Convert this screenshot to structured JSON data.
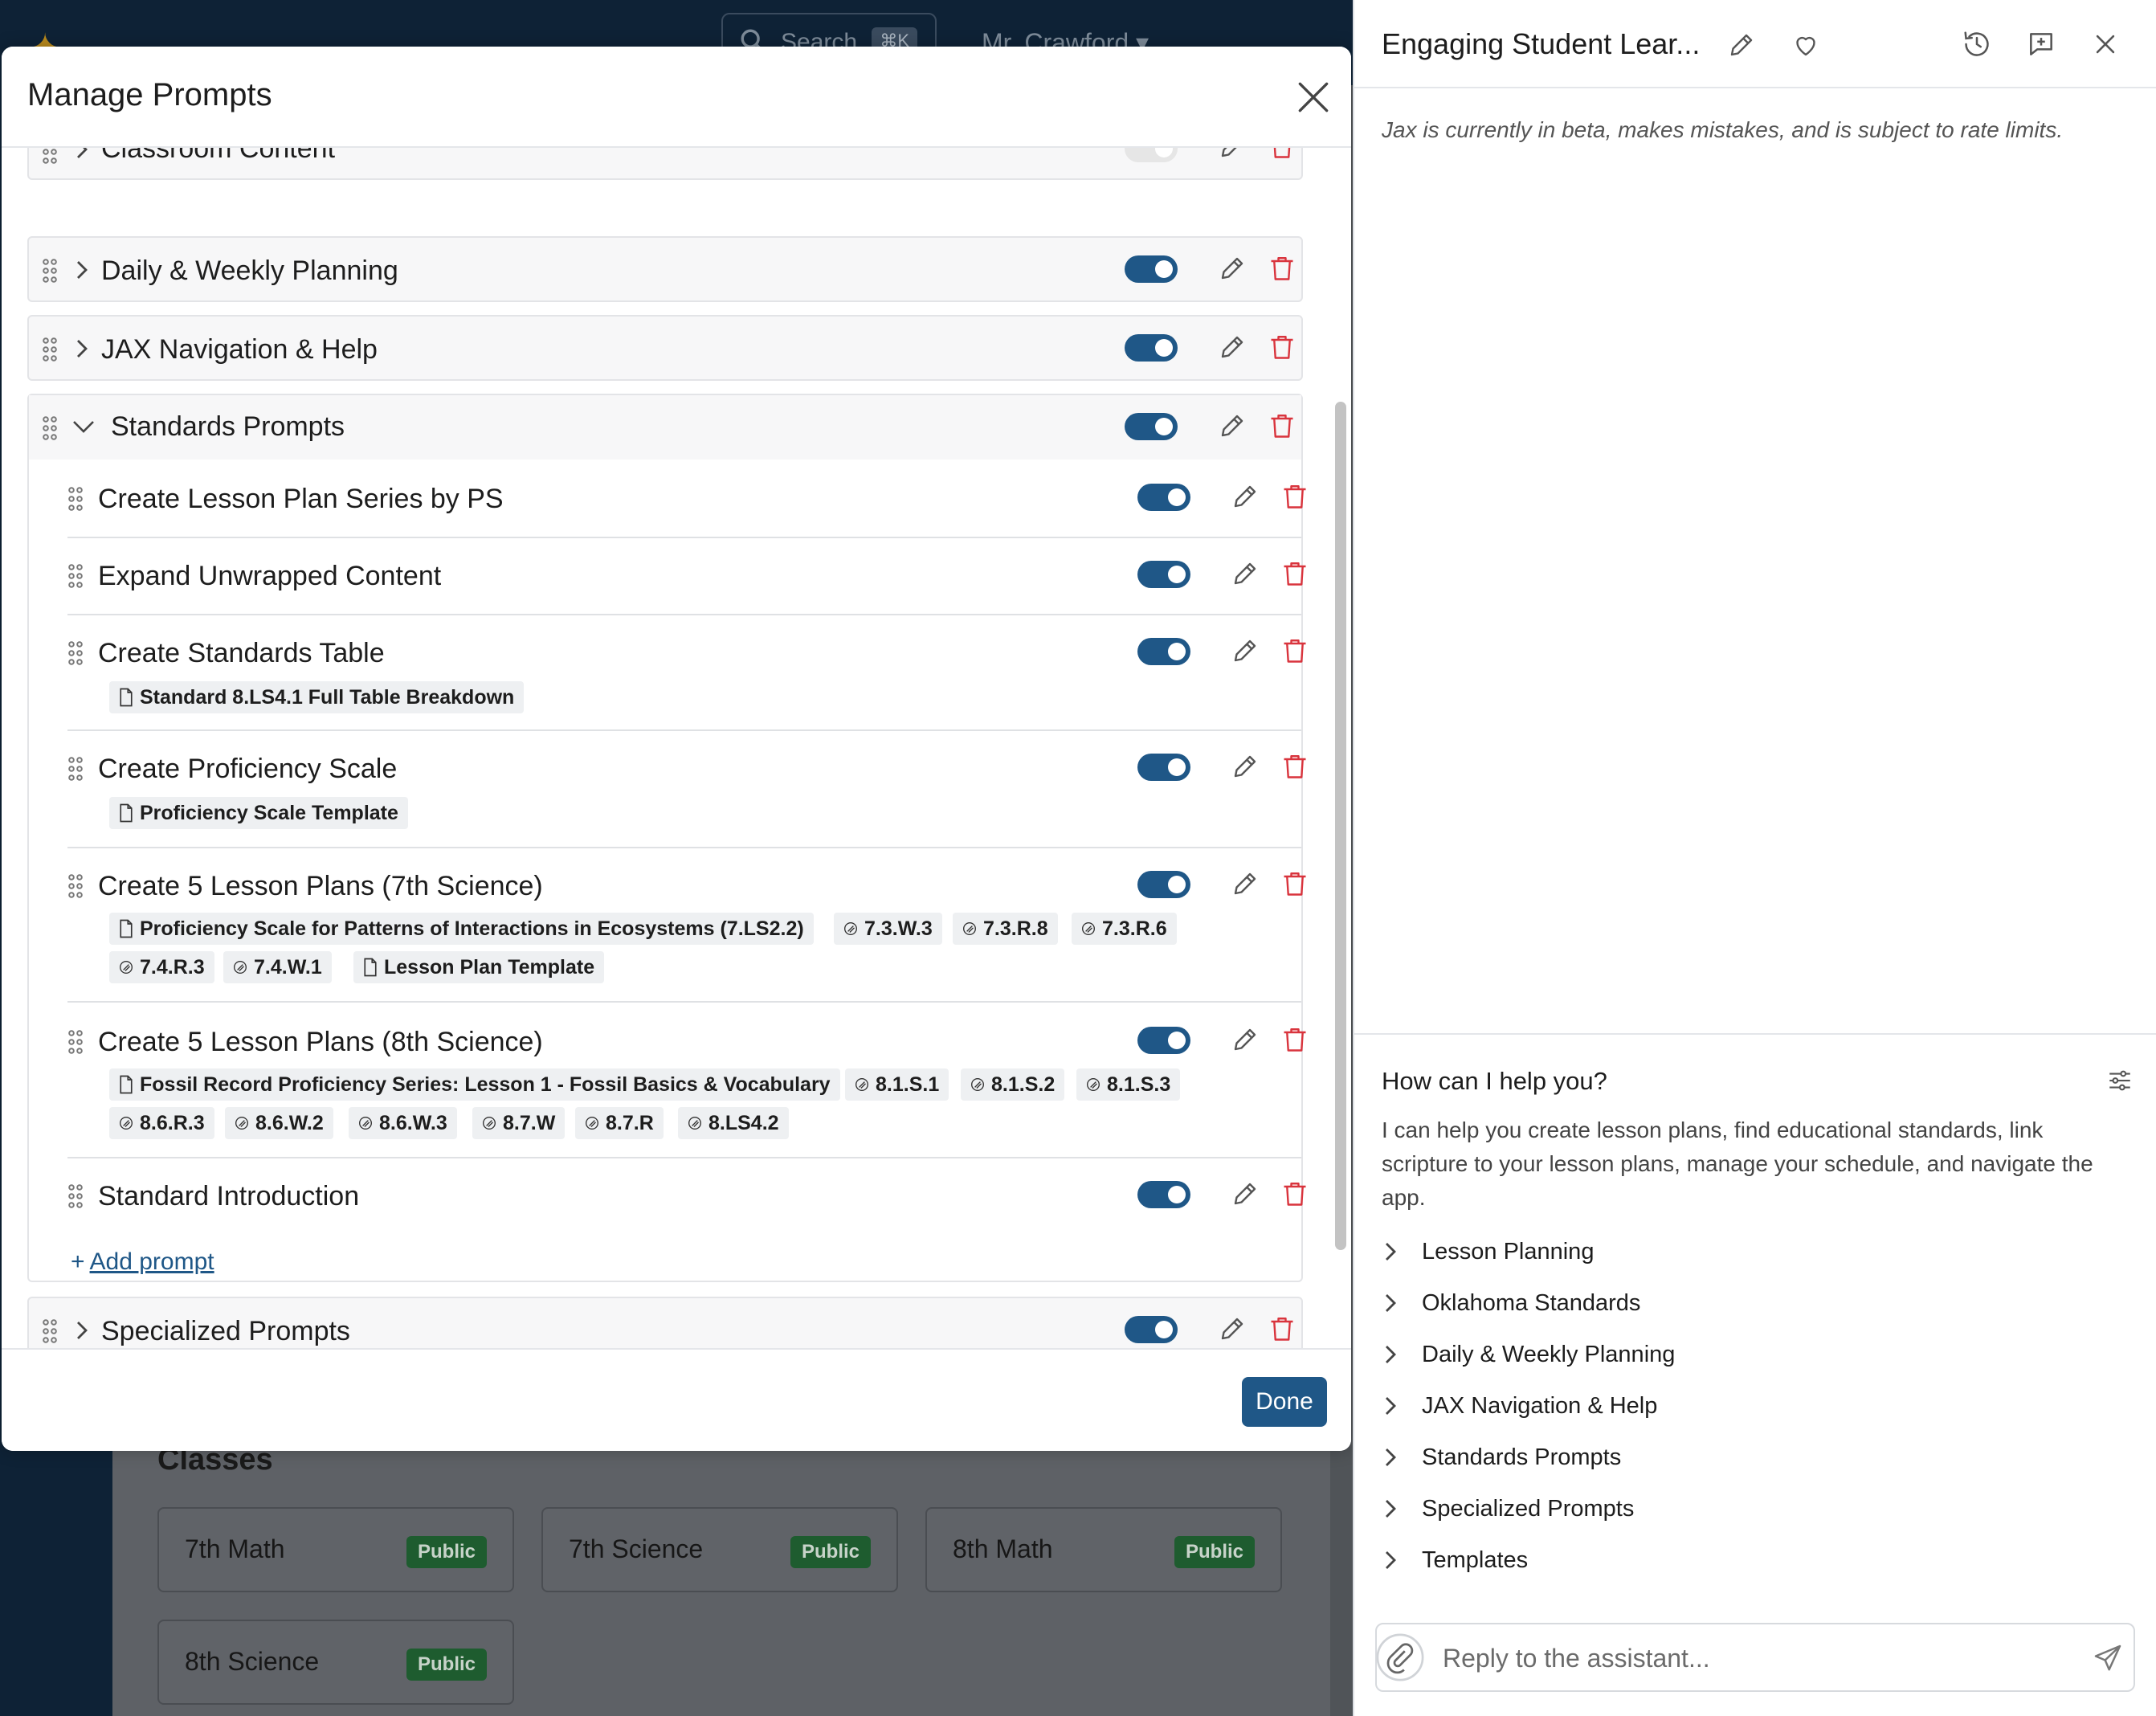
{
  "background_app": {
    "search_placeholder": "Search",
    "search_shortcut": "⌘K",
    "user_name": "Mr. Crawford",
    "classes_title": "Classes",
    "classes": [
      {
        "name": "7th Math",
        "badge": "Public"
      },
      {
        "name": "7th Science",
        "badge": "Public"
      },
      {
        "name": "8th Math",
        "badge": "Public"
      },
      {
        "name": "8th Science",
        "badge": "Public"
      }
    ]
  },
  "modal": {
    "title": "Manage Prompts",
    "done_label": "Done",
    "categories": [
      {
        "label": "Classroom Content",
        "enabled": false,
        "expanded": false
      },
      {
        "label": "Daily & Weekly Planning",
        "enabled": true,
        "expanded": false
      },
      {
        "label": "JAX Navigation & Help",
        "enabled": true,
        "expanded": false
      },
      {
        "label": "Standards Prompts",
        "enabled": true,
        "expanded": true
      },
      {
        "label": "Specialized Prompts",
        "enabled": true,
        "expanded": false
      }
    ],
    "standards_prompts": [
      {
        "label": "Create Lesson Plan Series by PS",
        "enabled": true,
        "attachments": []
      },
      {
        "label": "Expand Unwrapped Content",
        "enabled": true,
        "attachments": []
      },
      {
        "label": "Create Standards Table",
        "enabled": true,
        "attachments": [
          {
            "type": "document",
            "label": "Standard 8.LS4.1 Full Table Breakdown"
          }
        ]
      },
      {
        "label": "Create Proficiency Scale",
        "enabled": true,
        "attachments": [
          {
            "type": "document",
            "label": "Proficiency Scale Template"
          }
        ]
      },
      {
        "label": "Create 5 Lesson Plans (7th Science)",
        "enabled": true,
        "attachments": [
          {
            "type": "document",
            "label": "Proficiency Scale for Patterns of Interactions in Ecosystems (7.LS2.2)"
          },
          {
            "type": "standard",
            "label": "7.3.W.3"
          },
          {
            "type": "standard",
            "label": "7.3.R.8"
          },
          {
            "type": "standard",
            "label": "7.3.R.6"
          },
          {
            "type": "standard",
            "label": "7.4.R.3"
          },
          {
            "type": "standard",
            "label": "7.4.W.1"
          },
          {
            "type": "document",
            "label": "Lesson Plan Template"
          }
        ]
      },
      {
        "label": "Create 5 Lesson Plans (8th Science)",
        "enabled": true,
        "attachments": [
          {
            "type": "document",
            "label": "Fossil Record Proficiency Series: Lesson 1 - Fossil Basics & Vocabulary"
          },
          {
            "type": "standard",
            "label": "8.1.S.1"
          },
          {
            "type": "standard",
            "label": "8.1.S.2"
          },
          {
            "type": "standard",
            "label": "8.1.S.3"
          },
          {
            "type": "standard",
            "label": "8.6.R.3"
          },
          {
            "type": "standard",
            "label": "8.6.W.2"
          },
          {
            "type": "standard",
            "label": "8.6.W.3"
          },
          {
            "type": "standard",
            "label": "8.7.W"
          },
          {
            "type": "standard",
            "label": "8.7.R"
          },
          {
            "type": "standard",
            "label": "8.LS4.2"
          }
        ]
      },
      {
        "label": "Standard Introduction",
        "enabled": true,
        "attachments": []
      }
    ],
    "add_prompt_label": "Add prompt"
  },
  "assistant_panel": {
    "title": "Engaging Student Lear...",
    "beta_note": "Jax is currently in beta, makes mistakes, and is subject to rate limits.",
    "help_title": "How can I help you?",
    "help_description": "I can help you create lesson plans, find educational standards, link scripture to your lesson plans, manage your schedule, and navigate the app.",
    "help_topics": [
      "Lesson Planning",
      "Oklahoma Standards",
      "Daily & Weekly Planning",
      "JAX Navigation & Help",
      "Standards Prompts",
      "Specialized Prompts",
      "Templates"
    ],
    "reply_placeholder": "Reply to the assistant..."
  },
  "colors": {
    "accent": "#1f5787",
    "danger": "#d9343d",
    "badge_public": "#1e5c2f",
    "topbar": "#0e2236"
  }
}
